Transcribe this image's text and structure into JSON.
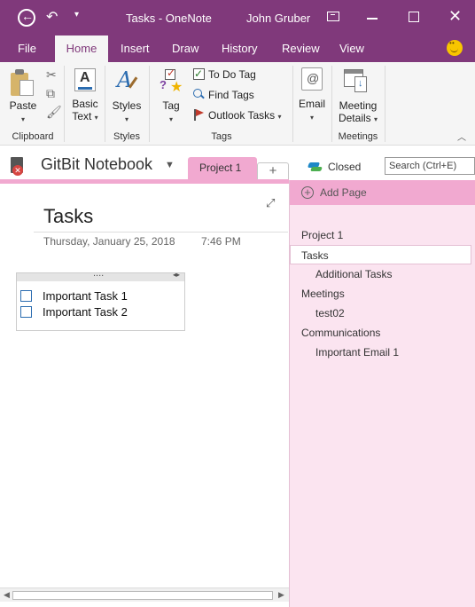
{
  "titlebar": {
    "app_title": "Tasks  -  OneNote",
    "user_name": "John Gruber"
  },
  "tabs": [
    {
      "label": "File"
    },
    {
      "label": "Home"
    },
    {
      "label": "Insert"
    },
    {
      "label": "Draw"
    },
    {
      "label": "History"
    },
    {
      "label": "Review"
    },
    {
      "label": "View"
    }
  ],
  "ribbon": {
    "clipboard": {
      "paste_label": "Paste",
      "group_label": "Clipboard"
    },
    "basic_text": {
      "label_line1": "Basic",
      "label_line2": "Text"
    },
    "styles": {
      "label": "Styles",
      "group_label": "Styles"
    },
    "tags": {
      "tag_label": "Tag",
      "todo_label": "To Do Tag",
      "find_label": "Find Tags",
      "outlook_label": "Outlook Tasks",
      "group_label": "Tags"
    },
    "email": {
      "label": "Email"
    },
    "meetings": {
      "label_line1": "Meeting",
      "label_line2": "Details",
      "group_label": "Meetings"
    }
  },
  "notebook": {
    "name": "GitBit Notebook",
    "section_tab": "Project 1",
    "add_section": "+",
    "closed_label": "Closed",
    "search_placeholder": "Search (Ctrl+E)"
  },
  "page": {
    "title": "Tasks",
    "date": "Thursday, January 25, 2018",
    "time": "7:46 PM",
    "tasks": [
      {
        "text": "Important Task 1",
        "checked": false
      },
      {
        "text": "Important Task 2",
        "checked": false
      }
    ]
  },
  "pagelist": {
    "add_page_label": "Add Page",
    "items": [
      {
        "label": "Project 1",
        "level": 0
      },
      {
        "label": "Tasks",
        "level": 0,
        "selected": true
      },
      {
        "label": "Additional Tasks",
        "level": 1
      },
      {
        "label": "Meetings",
        "level": 0
      },
      {
        "label": "test02",
        "level": 1
      },
      {
        "label": "Communications",
        "level": 0
      },
      {
        "label": "Important Email 1",
        "level": 1
      }
    ]
  },
  "colors": {
    "accent": "#80397b",
    "section_pink": "#f1a9d0",
    "pagelist_bg": "#fbe4f0"
  }
}
